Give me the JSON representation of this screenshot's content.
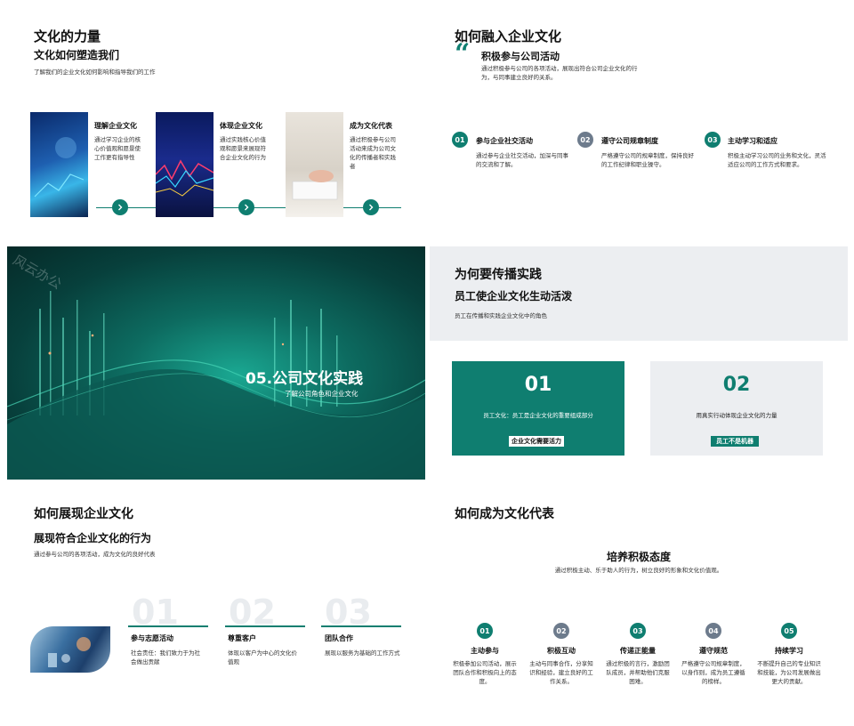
{
  "colors": {
    "teal": "#0f7e70",
    "gray": "#6d7b8c",
    "light_gray": "#eceef1",
    "dark_teal": "#0b3b3a"
  },
  "s1": {
    "title": "文化的力量",
    "subtitle": "文化如何塑造我们",
    "desc": "了解我们的企业文化如何影响和指导我们的工作",
    "items": [
      {
        "title": "理解企业文化",
        "text": "通过学习企业的核心价值观和愿景使工作更有指导性"
      },
      {
        "title": "体现企业文化",
        "text": "通过实践核心价值观和愿景来展现符合企业文化的行为"
      },
      {
        "title": "成为文化代表",
        "text": "通过积极参与公司活动来成为公司文化的传播者和实践者"
      }
    ],
    "arrow_icon": "chevron-right-icon"
  },
  "s2": {
    "title": "如何融入企业文化",
    "quote_title": "积极参与公司活动",
    "quote_text": "通过积极参与公司的各项活动，展现出符合公司企业文化的行为，与同事建立良好的关系。",
    "quote_icon": "quote-mark-icon",
    "items": [
      {
        "num": "01",
        "title": "参与企业社交活动",
        "text": "通过参与企业社交活动，加深与同事的交流和了解。"
      },
      {
        "num": "02",
        "title": "遵守公司规章制度",
        "text": "严格遵守公司的规章制度，保持良好的工作纪律和职业操守。"
      },
      {
        "num": "03",
        "title": "主动学习和适应",
        "text": "积极主动学习公司的业务和文化，灵活适应公司的工作方式和要求。"
      }
    ]
  },
  "s3": {
    "watermark": "风云办公",
    "title": "05.公司文化实践",
    "subtitle": "了解公司角色和企业文化"
  },
  "s4": {
    "title": "为何要传播实践",
    "subtitle": "员工使企业文化生动活泼",
    "desc": "员工在传播和实践企业文化中的角色",
    "cards": [
      {
        "num": "01",
        "text": "员工文化：员工是企业文化的重要组成部分",
        "tag": "企业文化需要活力"
      },
      {
        "num": "02",
        "text": "用真实行动体现企业文化的力量",
        "tag": "员工不是机器"
      }
    ]
  },
  "s5": {
    "title": "如何展现企业文化",
    "subtitle": "展现符合企业文化的行为",
    "desc": "通过参与公司的各项活动，成为文化的良好代表",
    "items": [
      {
        "num": "01",
        "title": "参与志愿活动",
        "text": "社会责任：我们致力于为社会做出贡献"
      },
      {
        "num": "02",
        "title": "尊重客户",
        "text": "体现以客户为中心的文化价值观"
      },
      {
        "num": "03",
        "title": "团队合作",
        "text": "展现以服务为基础的工作方式"
      }
    ]
  },
  "s6": {
    "title": "如何成为文化代表",
    "subtitle": "培养积极态度",
    "desc": "通过积极主动、乐于助人的行为，树立良好的形象和文化价值观。",
    "items": [
      {
        "num": "01",
        "title": "主动参与",
        "text": "积极参加公司活动，展示团队合作和积极向上的态度。"
      },
      {
        "num": "02",
        "title": "积极互动",
        "text": "主动与同事合作，分享知识和经验，建立良好的工作关系。"
      },
      {
        "num": "03",
        "title": "传递正能量",
        "text": "通过积极的言行，激励团队成员，并帮助他们克服困难。"
      },
      {
        "num": "04",
        "title": "遵守规范",
        "text": "严格遵守公司规章制度，以身作则，成为员工遵循的榜样。"
      },
      {
        "num": "05",
        "title": "持续学习",
        "text": "不断提升自己的专业知识和技能，为公司发展做出更大的贡献。"
      }
    ]
  }
}
